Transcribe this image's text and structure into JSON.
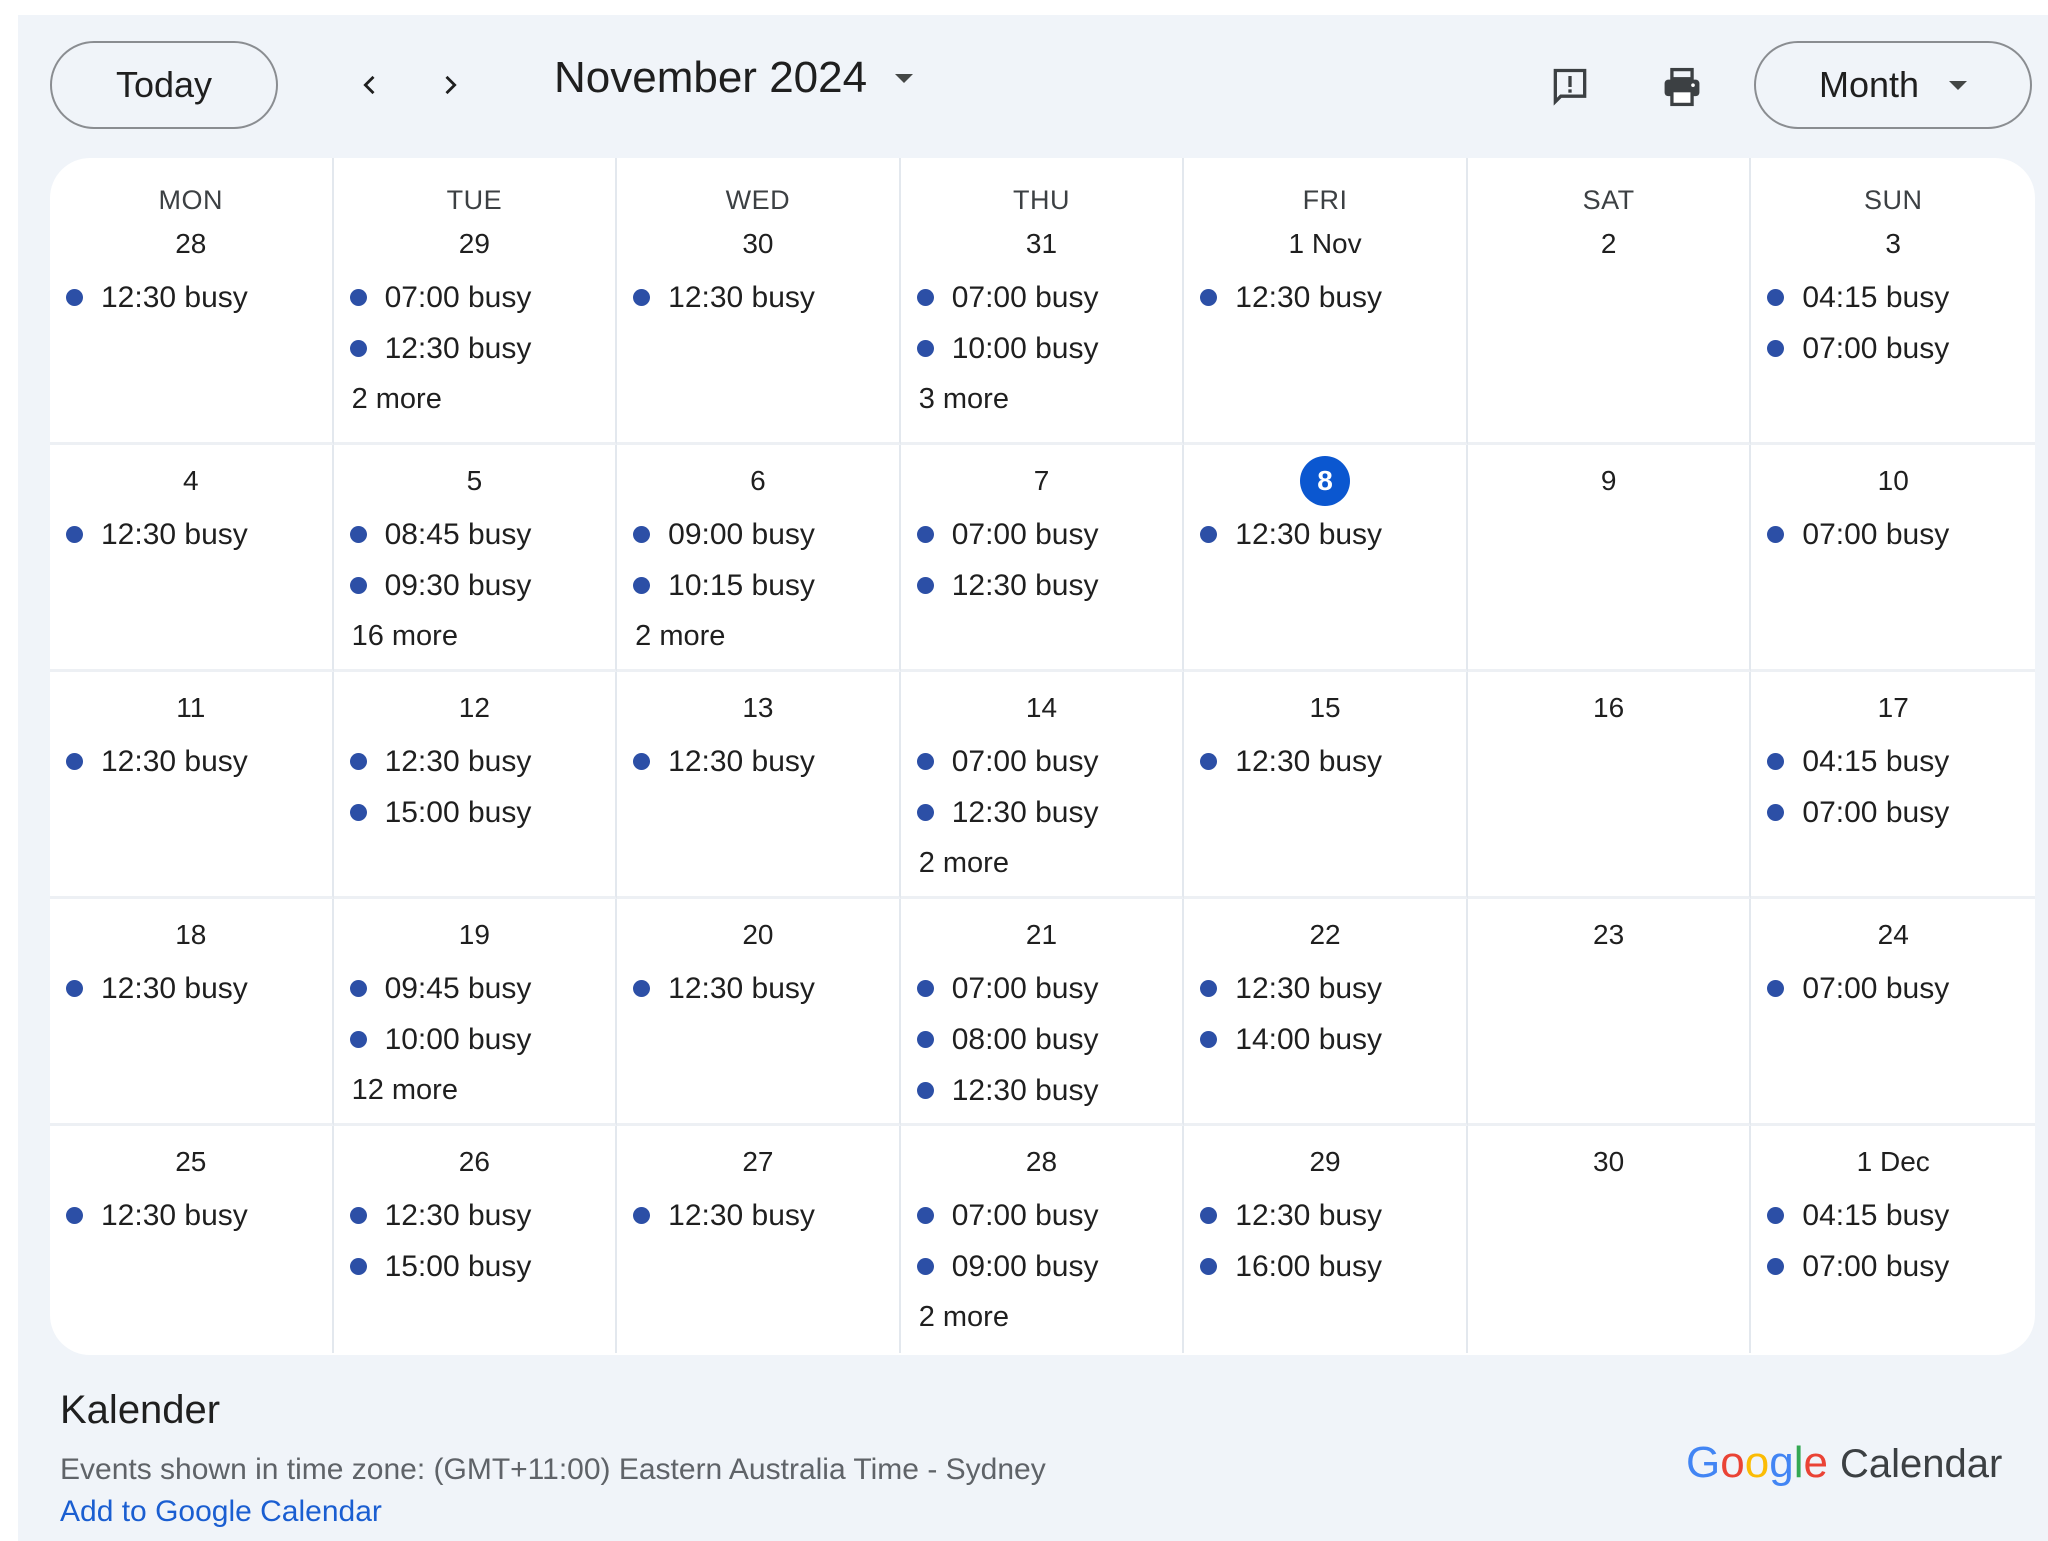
{
  "toolbar": {
    "today_label": "Today",
    "prev_icon": "chevron-left-icon",
    "next_icon": "chevron-right-icon",
    "title": "November 2024",
    "feedback_icon": "feedback-icon",
    "print_icon": "print-icon",
    "view_label": "Month"
  },
  "today_date": "8",
  "weekdays": [
    "MON",
    "TUE",
    "WED",
    "THU",
    "FRI",
    "SAT",
    "SUN"
  ],
  "weeks": [
    [
      {
        "day": "28",
        "events": [
          "12:30 busy"
        ],
        "more": ""
      },
      {
        "day": "29",
        "events": [
          "07:00 busy",
          "12:30 busy"
        ],
        "more": "2 more"
      },
      {
        "day": "30",
        "events": [
          "12:30 busy"
        ],
        "more": ""
      },
      {
        "day": "31",
        "events": [
          "07:00 busy",
          "10:00 busy"
        ],
        "more": "3 more"
      },
      {
        "day": "1 Nov",
        "events": [
          "12:30 busy"
        ],
        "more": ""
      },
      {
        "day": "2",
        "events": [],
        "more": ""
      },
      {
        "day": "3",
        "events": [
          "04:15 busy",
          "07:00 busy"
        ],
        "more": ""
      }
    ],
    [
      {
        "day": "4",
        "events": [
          "12:30 busy"
        ],
        "more": ""
      },
      {
        "day": "5",
        "events": [
          "08:45 busy",
          "09:30 busy"
        ],
        "more": "16 more"
      },
      {
        "day": "6",
        "events": [
          "09:00 busy",
          "10:15 busy"
        ],
        "more": "2 more"
      },
      {
        "day": "7",
        "events": [
          "07:00 busy",
          "12:30 busy"
        ],
        "more": ""
      },
      {
        "day": "8",
        "events": [
          "12:30 busy"
        ],
        "more": "",
        "today": true
      },
      {
        "day": "9",
        "events": [],
        "more": ""
      },
      {
        "day": "10",
        "events": [
          "07:00 busy"
        ],
        "more": ""
      }
    ],
    [
      {
        "day": "11",
        "events": [
          "12:30 busy"
        ],
        "more": ""
      },
      {
        "day": "12",
        "events": [
          "12:30 busy",
          "15:00 busy"
        ],
        "more": ""
      },
      {
        "day": "13",
        "events": [
          "12:30 busy"
        ],
        "more": ""
      },
      {
        "day": "14",
        "events": [
          "07:00 busy",
          "12:30 busy"
        ],
        "more": "2 more"
      },
      {
        "day": "15",
        "events": [
          "12:30 busy"
        ],
        "more": ""
      },
      {
        "day": "16",
        "events": [],
        "more": ""
      },
      {
        "day": "17",
        "events": [
          "04:15 busy",
          "07:00 busy"
        ],
        "more": ""
      }
    ],
    [
      {
        "day": "18",
        "events": [
          "12:30 busy"
        ],
        "more": ""
      },
      {
        "day": "19",
        "events": [
          "09:45 busy",
          "10:00 busy"
        ],
        "more": "12 more"
      },
      {
        "day": "20",
        "events": [
          "12:30 busy"
        ],
        "more": ""
      },
      {
        "day": "21",
        "events": [
          "07:00 busy",
          "08:00 busy",
          "12:30 busy"
        ],
        "more": ""
      },
      {
        "day": "22",
        "events": [
          "12:30 busy",
          "14:00 busy"
        ],
        "more": ""
      },
      {
        "day": "23",
        "events": [],
        "more": ""
      },
      {
        "day": "24",
        "events": [
          "07:00 busy"
        ],
        "more": ""
      }
    ],
    [
      {
        "day": "25",
        "events": [
          "12:30 busy"
        ],
        "more": ""
      },
      {
        "day": "26",
        "events": [
          "12:30 busy",
          "15:00 busy"
        ],
        "more": ""
      },
      {
        "day": "27",
        "events": [
          "12:30 busy"
        ],
        "more": ""
      },
      {
        "day": "28",
        "events": [
          "07:00 busy",
          "09:00 busy"
        ],
        "more": "2 more"
      },
      {
        "day": "29",
        "events": [
          "12:30 busy",
          "16:00 busy"
        ],
        "more": ""
      },
      {
        "day": "30",
        "events": [],
        "more": ""
      },
      {
        "day": "1 Dec",
        "events": [
          "04:15 busy",
          "07:00 busy"
        ],
        "more": ""
      }
    ]
  ],
  "footer": {
    "calendar_name": "Kalender",
    "timezone_text": "Events shown in time zone: (GMT+11:00) Eastern Australia Time - Sydney",
    "add_link": "Add to Google Calendar",
    "brand_google": [
      "G",
      "o",
      "o",
      "g",
      "l",
      "e"
    ],
    "brand_calendar": "Calendar"
  },
  "colors": {
    "event_dot": "#2c4fa6",
    "today_highlight": "#0b57d0",
    "link": "#1a5ed1",
    "page_background": "#f0f4f9"
  }
}
